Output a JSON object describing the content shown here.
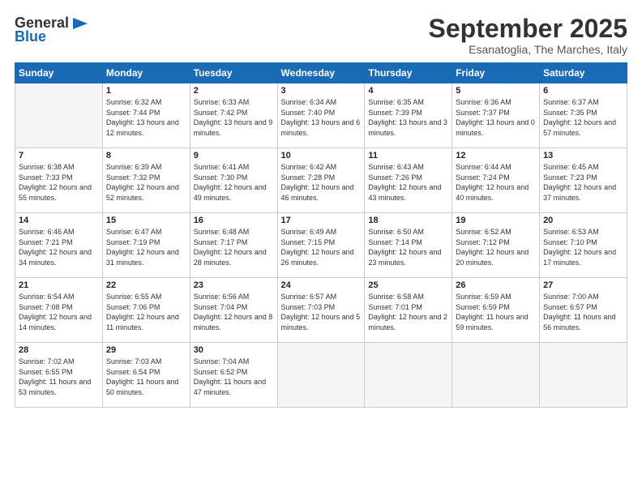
{
  "header": {
    "logo_general": "General",
    "logo_blue": "Blue",
    "month_title": "September 2025",
    "subtitle": "Esanatoglia, The Marches, Italy"
  },
  "weekdays": [
    "Sunday",
    "Monday",
    "Tuesday",
    "Wednesday",
    "Thursday",
    "Friday",
    "Saturday"
  ],
  "days": [
    {
      "date": "",
      "num": "",
      "sunrise": "",
      "sunset": "",
      "daylight": ""
    },
    {
      "num": "1",
      "sunrise": "Sunrise: 6:32 AM",
      "sunset": "Sunset: 7:44 PM",
      "daylight": "Daylight: 13 hours and 12 minutes."
    },
    {
      "num": "2",
      "sunrise": "Sunrise: 6:33 AM",
      "sunset": "Sunset: 7:42 PM",
      "daylight": "Daylight: 13 hours and 9 minutes."
    },
    {
      "num": "3",
      "sunrise": "Sunrise: 6:34 AM",
      "sunset": "Sunset: 7:40 PM",
      "daylight": "Daylight: 13 hours and 6 minutes."
    },
    {
      "num": "4",
      "sunrise": "Sunrise: 6:35 AM",
      "sunset": "Sunset: 7:39 PM",
      "daylight": "Daylight: 13 hours and 3 minutes."
    },
    {
      "num": "5",
      "sunrise": "Sunrise: 6:36 AM",
      "sunset": "Sunset: 7:37 PM",
      "daylight": "Daylight: 13 hours and 0 minutes."
    },
    {
      "num": "6",
      "sunrise": "Sunrise: 6:37 AM",
      "sunset": "Sunset: 7:35 PM",
      "daylight": "Daylight: 12 hours and 57 minutes."
    },
    {
      "num": "7",
      "sunrise": "Sunrise: 6:38 AM",
      "sunset": "Sunset: 7:33 PM",
      "daylight": "Daylight: 12 hours and 55 minutes."
    },
    {
      "num": "8",
      "sunrise": "Sunrise: 6:39 AM",
      "sunset": "Sunset: 7:32 PM",
      "daylight": "Daylight: 12 hours and 52 minutes."
    },
    {
      "num": "9",
      "sunrise": "Sunrise: 6:41 AM",
      "sunset": "Sunset: 7:30 PM",
      "daylight": "Daylight: 12 hours and 49 minutes."
    },
    {
      "num": "10",
      "sunrise": "Sunrise: 6:42 AM",
      "sunset": "Sunset: 7:28 PM",
      "daylight": "Daylight: 12 hours and 46 minutes."
    },
    {
      "num": "11",
      "sunrise": "Sunrise: 6:43 AM",
      "sunset": "Sunset: 7:26 PM",
      "daylight": "Daylight: 12 hours and 43 minutes."
    },
    {
      "num": "12",
      "sunrise": "Sunrise: 6:44 AM",
      "sunset": "Sunset: 7:24 PM",
      "daylight": "Daylight: 12 hours and 40 minutes."
    },
    {
      "num": "13",
      "sunrise": "Sunrise: 6:45 AM",
      "sunset": "Sunset: 7:23 PM",
      "daylight": "Daylight: 12 hours and 37 minutes."
    },
    {
      "num": "14",
      "sunrise": "Sunrise: 6:46 AM",
      "sunset": "Sunset: 7:21 PM",
      "daylight": "Daylight: 12 hours and 34 minutes."
    },
    {
      "num": "15",
      "sunrise": "Sunrise: 6:47 AM",
      "sunset": "Sunset: 7:19 PM",
      "daylight": "Daylight: 12 hours and 31 minutes."
    },
    {
      "num": "16",
      "sunrise": "Sunrise: 6:48 AM",
      "sunset": "Sunset: 7:17 PM",
      "daylight": "Daylight: 12 hours and 28 minutes."
    },
    {
      "num": "17",
      "sunrise": "Sunrise: 6:49 AM",
      "sunset": "Sunset: 7:15 PM",
      "daylight": "Daylight: 12 hours and 26 minutes."
    },
    {
      "num": "18",
      "sunrise": "Sunrise: 6:50 AM",
      "sunset": "Sunset: 7:14 PM",
      "daylight": "Daylight: 12 hours and 23 minutes."
    },
    {
      "num": "19",
      "sunrise": "Sunrise: 6:52 AM",
      "sunset": "Sunset: 7:12 PM",
      "daylight": "Daylight: 12 hours and 20 minutes."
    },
    {
      "num": "20",
      "sunrise": "Sunrise: 6:53 AM",
      "sunset": "Sunset: 7:10 PM",
      "daylight": "Daylight: 12 hours and 17 minutes."
    },
    {
      "num": "21",
      "sunrise": "Sunrise: 6:54 AM",
      "sunset": "Sunset: 7:08 PM",
      "daylight": "Daylight: 12 hours and 14 minutes."
    },
    {
      "num": "22",
      "sunrise": "Sunrise: 6:55 AM",
      "sunset": "Sunset: 7:06 PM",
      "daylight": "Daylight: 12 hours and 11 minutes."
    },
    {
      "num": "23",
      "sunrise": "Sunrise: 6:56 AM",
      "sunset": "Sunset: 7:04 PM",
      "daylight": "Daylight: 12 hours and 8 minutes."
    },
    {
      "num": "24",
      "sunrise": "Sunrise: 6:57 AM",
      "sunset": "Sunset: 7:03 PM",
      "daylight": "Daylight: 12 hours and 5 minutes."
    },
    {
      "num": "25",
      "sunrise": "Sunrise: 6:58 AM",
      "sunset": "Sunset: 7:01 PM",
      "daylight": "Daylight: 12 hours and 2 minutes."
    },
    {
      "num": "26",
      "sunrise": "Sunrise: 6:59 AM",
      "sunset": "Sunset: 6:59 PM",
      "daylight": "Daylight: 11 hours and 59 minutes."
    },
    {
      "num": "27",
      "sunrise": "Sunrise: 7:00 AM",
      "sunset": "Sunset: 6:57 PM",
      "daylight": "Daylight: 11 hours and 56 minutes."
    },
    {
      "num": "28",
      "sunrise": "Sunrise: 7:02 AM",
      "sunset": "Sunset: 6:55 PM",
      "daylight": "Daylight: 11 hours and 53 minutes."
    },
    {
      "num": "29",
      "sunrise": "Sunrise: 7:03 AM",
      "sunset": "Sunset: 6:54 PM",
      "daylight": "Daylight: 11 hours and 50 minutes."
    },
    {
      "num": "30",
      "sunrise": "Sunrise: 7:04 AM",
      "sunset": "Sunset: 6:52 PM",
      "daylight": "Daylight: 11 hours and 47 minutes."
    }
  ]
}
